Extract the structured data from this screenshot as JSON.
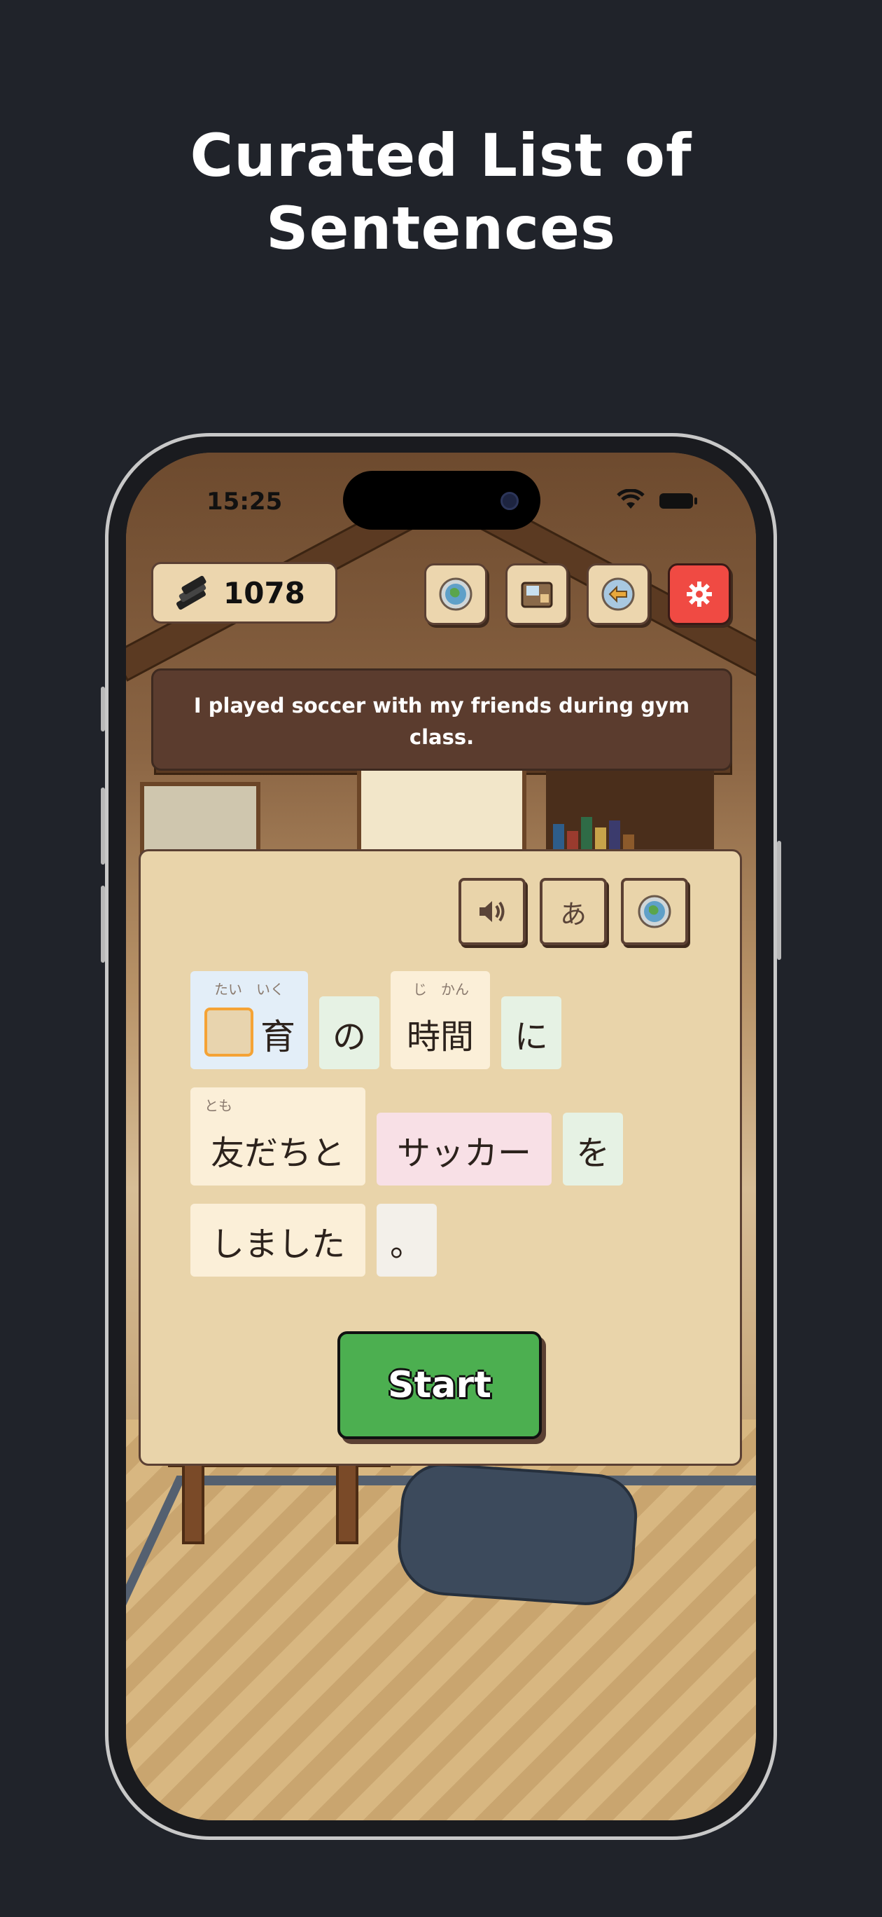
{
  "headline": {
    "line1": "Curated List of",
    "line2": "Sentences"
  },
  "status_bar": {
    "time": "15:25"
  },
  "top_bar": {
    "coin_count": "1078",
    "icons": [
      "globe-icon",
      "shop-register-icon",
      "back-arrow-icon",
      "gear-icon"
    ]
  },
  "english_sentence": "I played soccer with my friends during gym class.",
  "tools": {
    "sound_icon": "speaker-icon",
    "kana_label": "あ",
    "globe_icon": "globe-icon"
  },
  "tiles": [
    {
      "furigana": "たい　いく",
      "text": "育",
      "has_blank": true
    },
    {
      "furigana": "",
      "text": "の"
    },
    {
      "furigana": "じ　かん",
      "text": "時間"
    },
    {
      "furigana": "",
      "text": "に"
    },
    {
      "furigana": "とも",
      "text": "友だちと"
    },
    {
      "furigana": "",
      "text": "サッカー"
    },
    {
      "furigana": "",
      "text": "を"
    },
    {
      "furigana": "",
      "text": "しました"
    },
    {
      "furigana": "",
      "text": "。"
    }
  ],
  "start_label": "Start",
  "colors": {
    "page_bg": "#20232a",
    "card_bg": "#e9d4aa",
    "start_green": "#4caf50",
    "settings_red": "#f04a43",
    "sentence_bg": "#5b3c2e"
  }
}
